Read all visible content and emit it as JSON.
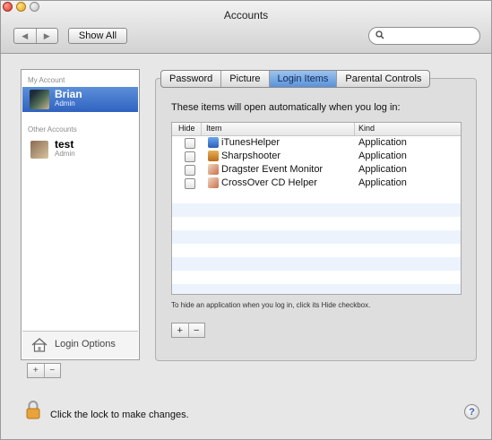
{
  "window": {
    "title": "Accounts"
  },
  "toolbar": {
    "show_all": "Show All",
    "back_glyph": "◀",
    "forward_glyph": "▶"
  },
  "search": {
    "value": "",
    "placeholder": ""
  },
  "sidebar": {
    "my_account_header": "My Account",
    "other_accounts_header": "Other Accounts",
    "accounts": [
      {
        "name": "Brian",
        "role": "Admin",
        "selected": true
      },
      {
        "name": "test",
        "role": "Admin",
        "selected": false
      }
    ],
    "login_options": "Login Options",
    "add_glyph": "+",
    "remove_glyph": "−"
  },
  "tabs": [
    {
      "label": "Password",
      "active": false
    },
    {
      "label": "Picture",
      "active": false
    },
    {
      "label": "Login Items",
      "active": true
    },
    {
      "label": "Parental Controls",
      "active": false
    }
  ],
  "login_items": {
    "heading": "These items will open automatically when you log in:",
    "columns": {
      "hide": "Hide",
      "item": "Item",
      "kind": "Kind"
    },
    "rows": [
      {
        "item": "iTunesHelper",
        "kind": "Application",
        "hide": false,
        "icon": "itunes-icon",
        "color": "#3b78d8"
      },
      {
        "item": "Sharpshooter",
        "kind": "Application",
        "hide": false,
        "icon": "sharpshooter-icon",
        "color": "#c9852a"
      },
      {
        "item": "Dragster Event Monitor",
        "kind": "Application",
        "hide": false,
        "icon": "application-icon",
        "color": "#c98a6a"
      },
      {
        "item": "CrossOver CD Helper",
        "kind": "Application",
        "hide": false,
        "icon": "application-icon",
        "color": "#c98a6a"
      }
    ],
    "hint": "To hide an application when you log in, click its Hide checkbox.",
    "add_glyph": "+",
    "remove_glyph": "−"
  },
  "footer": {
    "lock_text": "Click the lock to make changes.",
    "help_glyph": "?"
  },
  "colors": {
    "selection": "#3f74cc",
    "tab_active": "#6a9ee0",
    "lock": "#e8a33a"
  }
}
